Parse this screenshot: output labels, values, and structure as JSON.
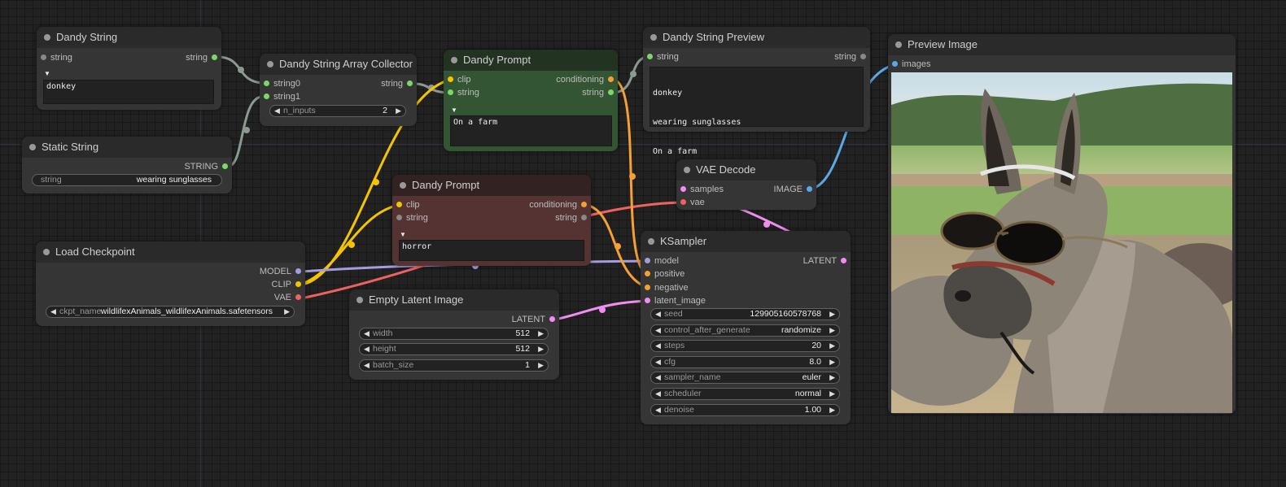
{
  "nodes": {
    "dandy_string": {
      "title": "Dandy String",
      "in_string": "string",
      "out_string": "string",
      "text": "donkey"
    },
    "static_string": {
      "title": "Static String",
      "out": "STRING",
      "widget_name": "string",
      "widget_value": "wearing sunglasses"
    },
    "collector": {
      "title": "Dandy String Array Collector",
      "in0": "string0",
      "in1": "string1",
      "out": "string",
      "widget_name": "n_inputs",
      "widget_value": "2"
    },
    "prompt1": {
      "title": "Dandy Prompt",
      "in_clip": "clip",
      "in_string": "string",
      "out_cond": "conditioning",
      "out_string": "string",
      "text": "On a farm"
    },
    "prompt2": {
      "title": "Dandy Prompt",
      "in_clip": "clip",
      "in_string": "string",
      "out_cond": "conditioning",
      "out_string": "string",
      "text": "horror"
    },
    "preview_str": {
      "title": "Dandy String Preview",
      "in_string": "string",
      "out_string": "string",
      "lines": [
        "donkey",
        "wearing sunglasses",
        "On a farm"
      ]
    },
    "preview_img": {
      "title": "Preview Image",
      "in_images": "images",
      "image_alt": "donkey wearing sunglasses"
    },
    "vae_decode": {
      "title": "VAE Decode",
      "in_samples": "samples",
      "in_vae": "vae",
      "out": "IMAGE"
    },
    "checkpoint": {
      "title": "Load Checkpoint",
      "out_model": "MODEL",
      "out_clip": "CLIP",
      "out_vae": "VAE",
      "widget_name": "ckpt_name",
      "widget_value": "wildlifexAnimals_wildlifexAnimals.safetensors"
    },
    "latent": {
      "title": "Empty Latent Image",
      "out": "LATENT",
      "widgets": [
        {
          "name": "width",
          "value": "512"
        },
        {
          "name": "height",
          "value": "512"
        },
        {
          "name": "batch_size",
          "value": "1"
        }
      ]
    },
    "ksampler": {
      "title": "KSampler",
      "in_model": "model",
      "in_positive": "positive",
      "in_negative": "negative",
      "in_latent": "latent_image",
      "out": "LATENT",
      "widgets": [
        {
          "name": "seed",
          "value": "129905160578768"
        },
        {
          "name": "control_after_generate",
          "value": "randomize"
        },
        {
          "name": "steps",
          "value": "20"
        },
        {
          "name": "cfg",
          "value": "8.0"
        },
        {
          "name": "sampler_name",
          "value": "euler"
        },
        {
          "name": "scheduler",
          "value": "normal"
        },
        {
          "name": "denoise",
          "value": "1.00"
        }
      ]
    }
  },
  "colors": {
    "string": "#7dd86b",
    "clip": "#f5c400",
    "model": "#a59ce0",
    "vae": "#ef6262",
    "conditioning": "#f5a030",
    "latent": "#f08ef0",
    "image": "#5aa8e8",
    "link_string": "#93a89c"
  }
}
